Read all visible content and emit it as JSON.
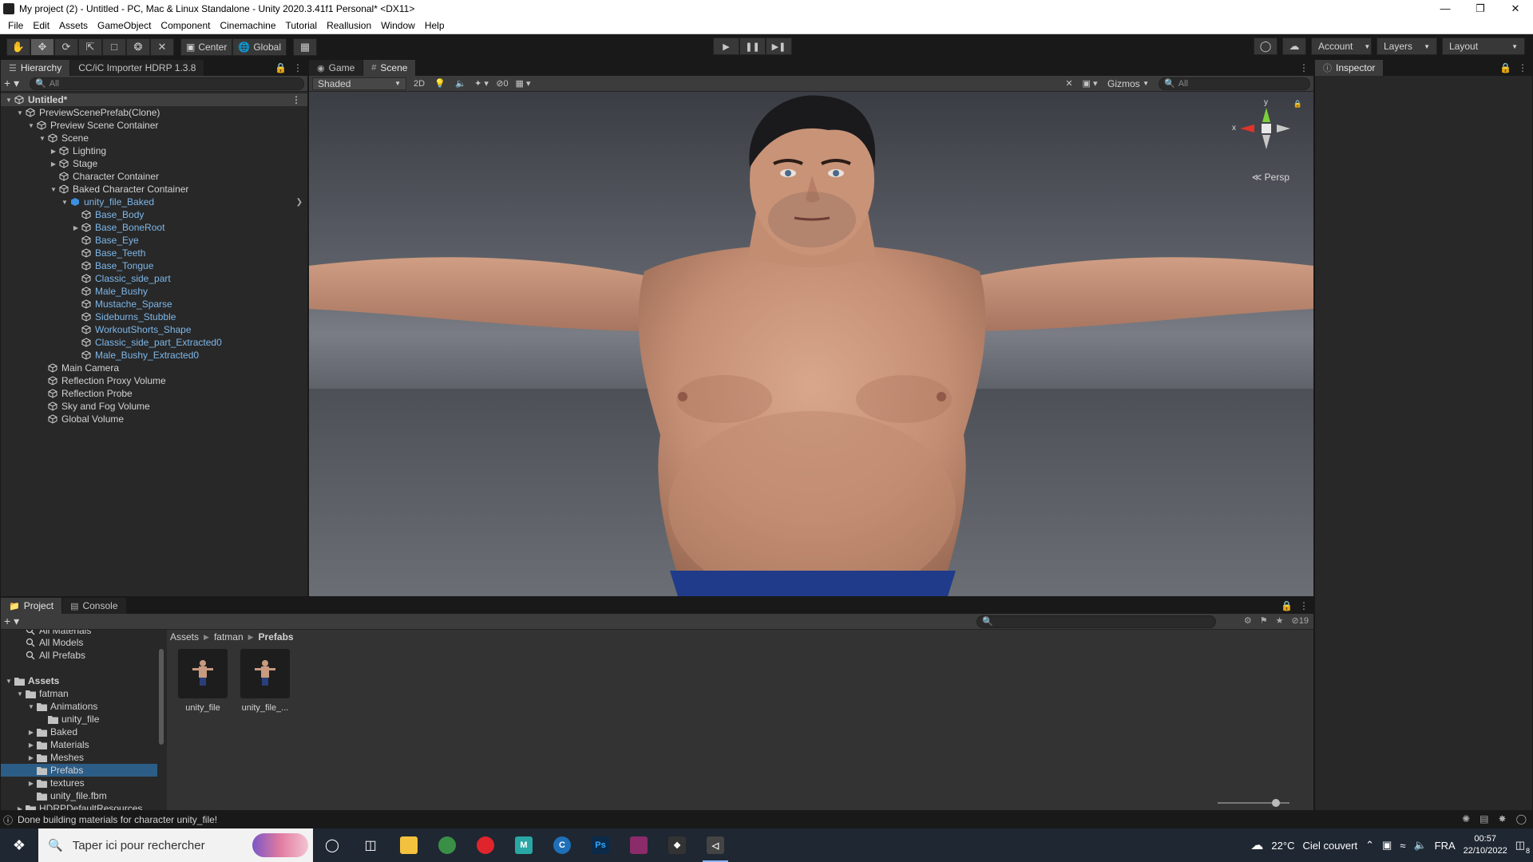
{
  "window": {
    "title": "My project (2) - Untitled - PC, Mac & Linux Standalone - Unity 2020.3.41f1 Personal* <DX11>"
  },
  "menu": [
    "File",
    "Edit",
    "Assets",
    "GameObject",
    "Component",
    "Cinemachine",
    "Tutorial",
    "Reallusion",
    "Window",
    "Help"
  ],
  "toolbar": {
    "pivot_label": "Center",
    "space_label": "Global",
    "account_label": "Account",
    "layers_label": "Layers",
    "layout_label": "Layout"
  },
  "hierarchy": {
    "tabs": [
      "Hierarchy",
      "CC/iC Importer HDRP 1.3.8"
    ],
    "search_placeholder": "All",
    "rows": [
      {
        "label": "Untitled*",
        "depth": 0,
        "arrow": "down",
        "style": "root"
      },
      {
        "label": "PreviewScenePrefab(Clone)",
        "depth": 1,
        "arrow": "down"
      },
      {
        "label": "Preview Scene Container",
        "depth": 2,
        "arrow": "down"
      },
      {
        "label": "Scene",
        "depth": 3,
        "arrow": "down"
      },
      {
        "label": "Lighting",
        "depth": 4,
        "arrow": "right"
      },
      {
        "label": "Stage",
        "depth": 4,
        "arrow": "right"
      },
      {
        "label": "Character Container",
        "depth": 4,
        "arrow": ""
      },
      {
        "label": "Baked Character Container",
        "depth": 4,
        "arrow": "down"
      },
      {
        "label": "unity_file_Baked",
        "depth": 5,
        "arrow": "down",
        "style": "blue",
        "prefab": true
      },
      {
        "label": "Base_Body",
        "depth": 6,
        "arrow": "",
        "style": "blue"
      },
      {
        "label": "Base_BoneRoot",
        "depth": 6,
        "arrow": "right",
        "style": "blue"
      },
      {
        "label": "Base_Eye",
        "depth": 6,
        "arrow": "",
        "style": "blue"
      },
      {
        "label": "Base_Teeth",
        "depth": 6,
        "arrow": "",
        "style": "blue"
      },
      {
        "label": "Base_Tongue",
        "depth": 6,
        "arrow": "",
        "style": "blue"
      },
      {
        "label": "Classic_side_part",
        "depth": 6,
        "arrow": "",
        "style": "blue"
      },
      {
        "label": "Male_Bushy",
        "depth": 6,
        "arrow": "",
        "style": "blue"
      },
      {
        "label": "Mustache_Sparse",
        "depth": 6,
        "arrow": "",
        "style": "blue"
      },
      {
        "label": "Sideburns_Stubble",
        "depth": 6,
        "arrow": "",
        "style": "blue"
      },
      {
        "label": "WorkoutShorts_Shape",
        "depth": 6,
        "arrow": "",
        "style": "blue"
      },
      {
        "label": "Classic_side_part_Extracted0",
        "depth": 6,
        "arrow": "",
        "style": "blue"
      },
      {
        "label": "Male_Bushy_Extracted0",
        "depth": 6,
        "arrow": "",
        "style": "blue"
      },
      {
        "label": "Main Camera",
        "depth": 3,
        "arrow": ""
      },
      {
        "label": "Reflection Proxy Volume",
        "depth": 3,
        "arrow": ""
      },
      {
        "label": "Reflection Probe",
        "depth": 3,
        "arrow": ""
      },
      {
        "label": "Sky and Fog Volume",
        "depth": 3,
        "arrow": ""
      },
      {
        "label": "Global Volume",
        "depth": 3,
        "arrow": ""
      }
    ]
  },
  "scene_view": {
    "tabs": [
      "Game",
      "Scene"
    ],
    "shading_mode": "Shaded",
    "mode_2d": "2D",
    "hidden_count": "0",
    "gizmos_label": "Gizmos",
    "search_placeholder": "All",
    "projection_label": "Persp",
    "axis_y": "y",
    "axis_x": "x"
  },
  "inspector": {
    "tab": "Inspector"
  },
  "project": {
    "tabs": [
      "Project",
      "Console"
    ],
    "visible_count": "19",
    "breadcrumb": [
      "Assets",
      "fatman",
      "Prefabs"
    ],
    "tree": [
      {
        "label": "All Materials",
        "depth": 1,
        "arrow": "",
        "icon": "search",
        "partial": true
      },
      {
        "label": "All Models",
        "depth": 1,
        "arrow": "",
        "icon": "search"
      },
      {
        "label": "All Prefabs",
        "depth": 1,
        "arrow": "",
        "icon": "search"
      },
      {
        "label": "",
        "depth": 0,
        "arrow": "",
        "icon": "none"
      },
      {
        "label": "Assets",
        "depth": 0,
        "arrow": "down",
        "icon": "folder",
        "bold": true
      },
      {
        "label": "fatman",
        "depth": 1,
        "arrow": "down",
        "icon": "folder"
      },
      {
        "label": "Animations",
        "depth": 2,
        "arrow": "down",
        "icon": "folder"
      },
      {
        "label": "unity_file",
        "depth": 3,
        "arrow": "",
        "icon": "folder"
      },
      {
        "label": "Baked",
        "depth": 2,
        "arrow": "right",
        "icon": "folder"
      },
      {
        "label": "Materials",
        "depth": 2,
        "arrow": "right",
        "icon": "folder"
      },
      {
        "label": "Meshes",
        "depth": 2,
        "arrow": "right",
        "icon": "folder"
      },
      {
        "label": "Prefabs",
        "depth": 2,
        "arrow": "",
        "icon": "folder",
        "selected": true
      },
      {
        "label": "textures",
        "depth": 2,
        "arrow": "right",
        "icon": "folder"
      },
      {
        "label": "unity_file.fbm",
        "depth": 2,
        "arrow": "",
        "icon": "folder"
      },
      {
        "label": "HDRPDefaultResources",
        "depth": 1,
        "arrow": "right",
        "icon": "folder"
      }
    ],
    "assets": [
      {
        "name": "unity_file"
      },
      {
        "name": "unity_file_..."
      }
    ]
  },
  "status": {
    "message": "Done building materials for character unity_file!"
  },
  "taskbar": {
    "search_placeholder": "Taper ici pour rechercher",
    "weather_temp": "22°C",
    "weather_desc": "Ciel couvert",
    "language": "FRA",
    "time": "00:57",
    "date": "22/10/2022",
    "notification_count": "8"
  },
  "colors": {
    "accent_selection": "#2c5d87",
    "prefab_text": "#7db7ea",
    "panel_bg": "#282828",
    "toolbar_bg": "#191919"
  }
}
